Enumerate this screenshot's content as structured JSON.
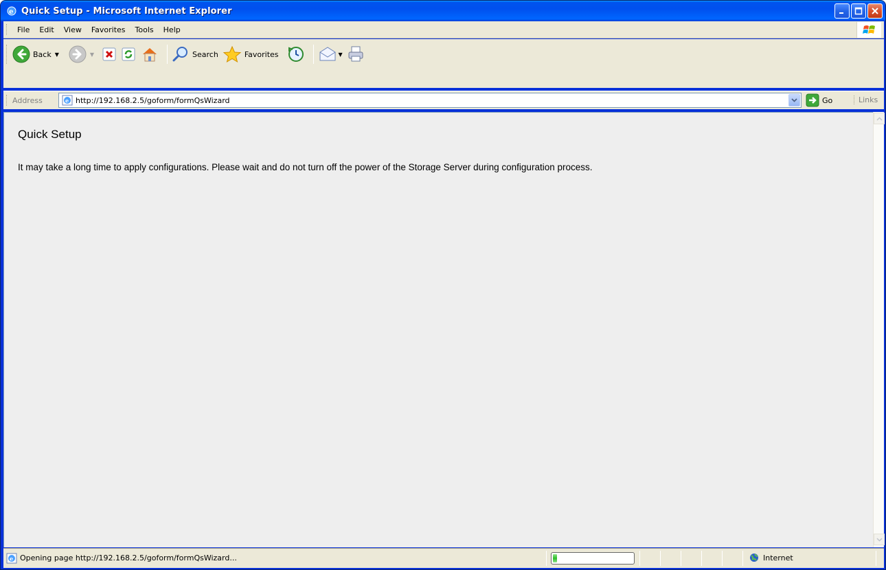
{
  "window": {
    "title": "Quick Setup - Microsoft Internet Explorer"
  },
  "menu": {
    "items": [
      "File",
      "Edit",
      "View",
      "Favorites",
      "Tools",
      "Help"
    ]
  },
  "toolbar": {
    "back_label": "Back",
    "search_label": "Search",
    "favorites_label": "Favorites"
  },
  "address": {
    "label": "Address",
    "url": "http://192.168.2.5/goform/formQsWizard",
    "go_label": "Go",
    "links_label": "Links"
  },
  "page": {
    "title": "Quick Setup",
    "message": "It may take a long time to apply configurations. Please wait and do not turn off the power of the Storage Server during configuration process."
  },
  "status": {
    "text": "Opening page http://192.168.2.5/goform/formQsWizard...",
    "progress_fraction": 0.05,
    "zone": "Internet"
  },
  "colors": {
    "titlebar": "#0053ee",
    "chrome": "#ece9d8",
    "content_bg": "#eeeeee"
  }
}
